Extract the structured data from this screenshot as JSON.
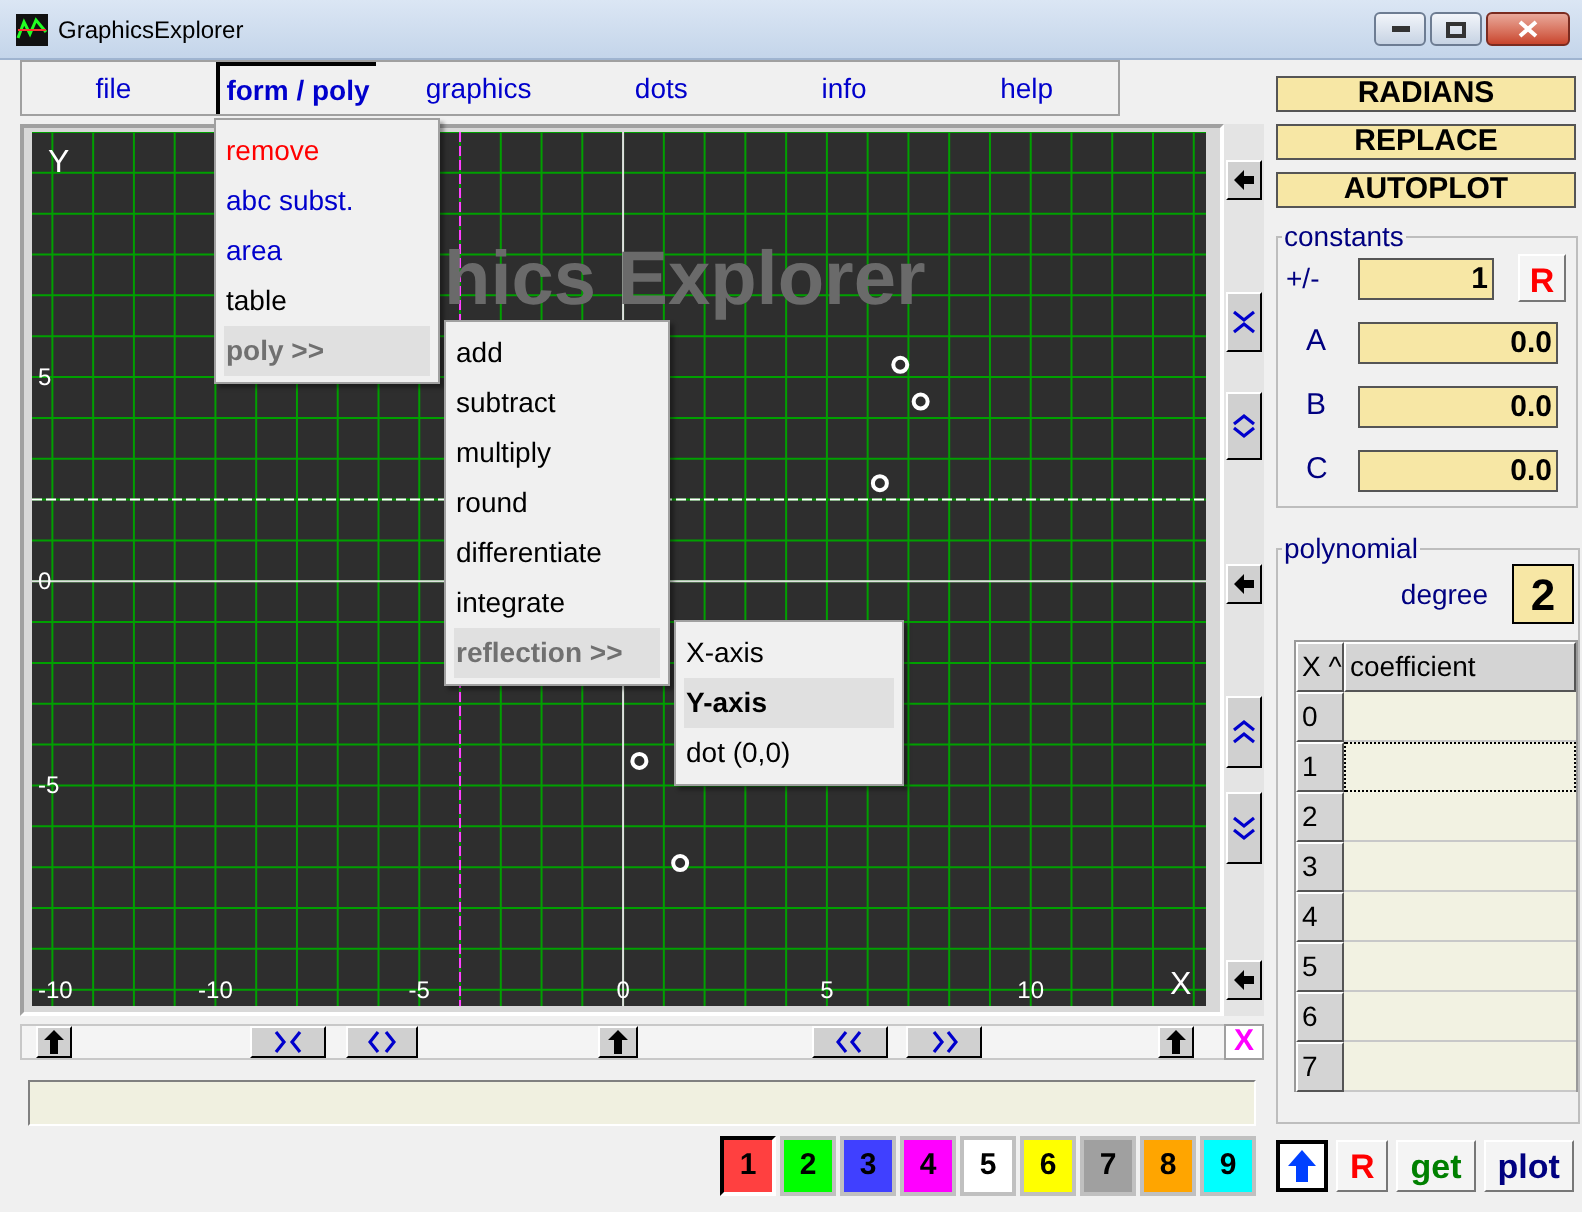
{
  "window": {
    "title": "GraphicsExplorer"
  },
  "menu_bar": {
    "tabs": [
      {
        "label": "file",
        "selected": false
      },
      {
        "label": "form / poly",
        "selected": true
      },
      {
        "label": "graphics",
        "selected": false
      },
      {
        "label": "dots",
        "selected": false
      },
      {
        "label": "info",
        "selected": false
      },
      {
        "label": "help",
        "selected": false
      }
    ]
  },
  "menus": [
    {
      "items": [
        {
          "label": "remove",
          "color": "#ff0000",
          "selected": false
        },
        {
          "label": "abc subst.",
          "color": "#0000cc",
          "selected": false
        },
        {
          "label": "area",
          "color": "#0000cc",
          "selected": false
        },
        {
          "label": "table",
          "color": "#000000",
          "selected": false
        },
        {
          "label": "poly >>",
          "color": "#707070",
          "selected": true
        }
      ]
    },
    {
      "items": [
        {
          "label": "add",
          "color": "#000000",
          "selected": false
        },
        {
          "label": "subtract",
          "color": "#000000",
          "selected": false
        },
        {
          "label": "multiply",
          "color": "#000000",
          "selected": false
        },
        {
          "label": "round",
          "color": "#000000",
          "selected": false
        },
        {
          "label": "differentiate",
          "color": "#000000",
          "selected": false
        },
        {
          "label": "integrate",
          "color": "#000000",
          "selected": false
        },
        {
          "label": "reflection >>",
          "color": "#707070",
          "selected": true
        }
      ]
    },
    {
      "items": [
        {
          "label": "X-axis",
          "color": "#000000",
          "selected": false
        },
        {
          "label": "Y-axis",
          "color": "#000000",
          "selected": true
        },
        {
          "label": "dot (0,0)",
          "color": "#000000",
          "selected": false
        }
      ]
    }
  ],
  "plot": {
    "watermark": "hics Explorer",
    "chart_data": {
      "type": "scatter",
      "xlabel": "X",
      "ylabel": "Y",
      "xlim": [
        -14.5,
        14.3
      ],
      "ylim": [
        -10.4,
        11.0
      ],
      "xticks": [
        -10,
        -5,
        0,
        5,
        10
      ],
      "yticks": [
        -10,
        -5,
        0,
        5
      ],
      "grid": true,
      "series": [
        {
          "color": "#ffffff",
          "x": [
            6.8,
            7.3,
            6.3,
            0.4,
            1.4
          ],
          "values": [
            5.3,
            4.4,
            2.4,
            -4.4,
            -6.9
          ]
        }
      ],
      "ref_lines": [
        {
          "axis": "x",
          "value": -4.0,
          "color": "#ff40ff"
        },
        {
          "axis": "y",
          "value": 2.0,
          "color": "#ffffff"
        }
      ]
    }
  },
  "clear_button": "X",
  "color_buttons": [
    {
      "label": "1",
      "color": "#ff4040",
      "selected": true
    },
    {
      "label": "2",
      "color": "#00ff00",
      "selected": false
    },
    {
      "label": "3",
      "color": "#4040ff",
      "selected": false
    },
    {
      "label": "4",
      "color": "#ff00ff",
      "selected": false
    },
    {
      "label": "5",
      "color": "#ffffff",
      "selected": false
    },
    {
      "label": "6",
      "color": "#ffff00",
      "selected": false
    },
    {
      "label": "7",
      "color": "#a0a0a0",
      "selected": false
    },
    {
      "label": "8",
      "color": "#ffa500",
      "selected": false
    },
    {
      "label": "9",
      "color": "#00ffff",
      "selected": false
    }
  ],
  "mode_buttons": [
    "RADIANS",
    "REPLACE",
    "AUTOPLOT"
  ],
  "constants": {
    "title": "constants",
    "rows": [
      {
        "label": "+/-",
        "value": "1",
        "reset": "R"
      },
      {
        "label": "A",
        "value": "0.0"
      },
      {
        "label": "B",
        "value": "0.0"
      },
      {
        "label": "C",
        "value": "0.0"
      }
    ]
  },
  "polynomial": {
    "title": "polynomial",
    "degree_label": "degree",
    "degree": "2",
    "columns": [
      "X ^",
      "coefficient"
    ],
    "rows": [
      {
        "power": "0",
        "focused": false
      },
      {
        "power": "1",
        "focused": true
      },
      {
        "power": "2",
        "focused": false
      },
      {
        "power": "3",
        "focused": false
      },
      {
        "power": "4",
        "focused": false
      },
      {
        "power": "5",
        "focused": false
      },
      {
        "power": "6",
        "focused": false
      },
      {
        "power": "7",
        "focused": false
      }
    ]
  },
  "action_buttons": [
    {
      "kind": "icon"
    },
    {
      "kind": "text",
      "label": "R",
      "color": "#ff0000"
    },
    {
      "kind": "text",
      "label": "get",
      "color": "#008000"
    },
    {
      "kind": "text",
      "label": "plot",
      "color": "#000080"
    }
  ]
}
